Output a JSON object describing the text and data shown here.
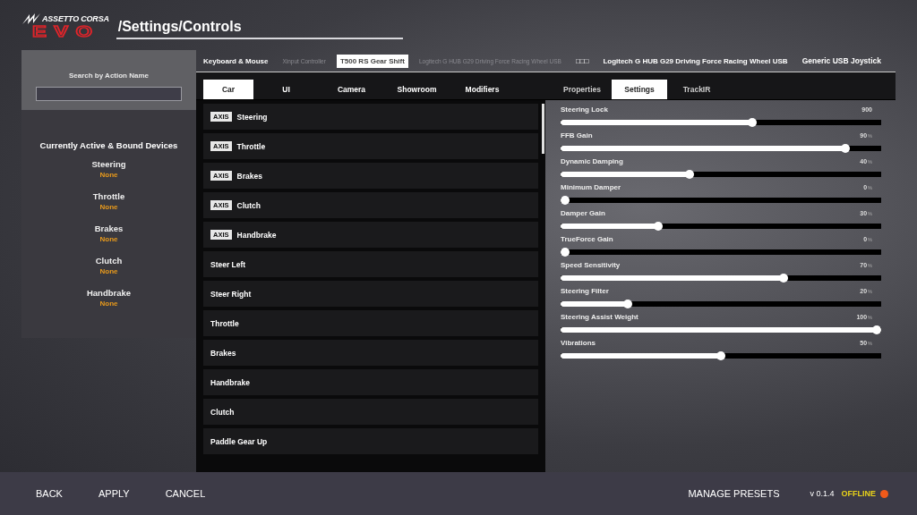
{
  "logo": {
    "top": "ASSETTO CORSA",
    "bottom": "EVO"
  },
  "title": "/Settings/Controls",
  "search": {
    "label": "Search by Action Name"
  },
  "bound_devices": {
    "title": "Currently Active & Bound Devices",
    "items": [
      {
        "name": "Steering",
        "device": "None"
      },
      {
        "name": "Throttle",
        "device": "None"
      },
      {
        "name": "Brakes",
        "device": "None"
      },
      {
        "name": "Clutch",
        "device": "None"
      },
      {
        "name": "Handbrake",
        "device": "None"
      }
    ]
  },
  "devices": [
    {
      "label": "Keyboard & Mouse",
      "selected": false,
      "disabled": false
    },
    {
      "label": "Xinput Controller",
      "selected": false,
      "disabled": true
    },
    {
      "label": "T500 RS Gear Shift",
      "selected": true,
      "disabled": false
    },
    {
      "label": "Logitech G HUB G29 Driving Force Racing Wheel USB",
      "selected": false,
      "disabled": true
    },
    {
      "label": "□□□",
      "selected": false,
      "disabled": false
    },
    {
      "label": "Logitech G HUB G29 Driving Force Racing Wheel USB",
      "selected": false,
      "disabled": false
    },
    {
      "label": "Generic USB Joystick",
      "selected": false,
      "disabled": false
    }
  ],
  "category_tabs": [
    {
      "label": "Car",
      "selected": true
    },
    {
      "label": "UI",
      "selected": false
    },
    {
      "label": "Camera",
      "selected": false
    },
    {
      "label": "Showroom",
      "selected": false
    },
    {
      "label": "Modifiers",
      "selected": false
    }
  ],
  "actions": [
    {
      "label": "Steering",
      "badge": "AXIS"
    },
    {
      "label": "Throttle",
      "badge": "AXIS"
    },
    {
      "label": "Brakes",
      "badge": "AXIS"
    },
    {
      "label": "Clutch",
      "badge": "AXIS"
    },
    {
      "label": "Handbrake",
      "badge": "AXIS"
    },
    {
      "label": "Steer Left"
    },
    {
      "label": "Steer Right"
    },
    {
      "label": "Throttle"
    },
    {
      "label": "Brakes"
    },
    {
      "label": "Handbrake"
    },
    {
      "label": "Clutch"
    },
    {
      "label": "Paddle Gear Up"
    }
  ],
  "settings_tabs": [
    {
      "label": "Properties",
      "selected": false
    },
    {
      "label": "Settings",
      "selected": true
    },
    {
      "label": "TrackIR",
      "selected": false
    }
  ],
  "sliders": [
    {
      "name": "Steering Lock",
      "value": "900",
      "level": 0.6
    },
    {
      "name": "FFB Gain",
      "value": "90",
      "unit": "%",
      "level": 0.9
    },
    {
      "name": "Dynamic Damping",
      "value": "40",
      "unit": "%",
      "level": 0.4
    },
    {
      "name": "Minimum Damper",
      "value": "0",
      "unit": "%",
      "level": 0
    },
    {
      "name": "Damper Gain",
      "value": "30",
      "unit": "%",
      "level": 0.3
    },
    {
      "name": "TrueForce Gain",
      "value": "0",
      "unit": "%",
      "level": 0
    },
    {
      "name": "Speed Sensitivity",
      "value": "70",
      "unit": "%",
      "level": 0.7
    },
    {
      "name": "Steering Filter",
      "value": "20",
      "unit": "%",
      "level": 0.2
    },
    {
      "name": "Steering Assist Weight",
      "value": "100",
      "unit": "%",
      "level": 1
    },
    {
      "name": "Vibrations",
      "value": "50",
      "unit": "%",
      "level": 0.5
    }
  ],
  "footer": {
    "buttons": [
      "BACK",
      "APPLY",
      "CANCEL"
    ],
    "presets": "MANAGE PRESETS",
    "version": "v 0.1.4",
    "status": "OFFLINE"
  }
}
